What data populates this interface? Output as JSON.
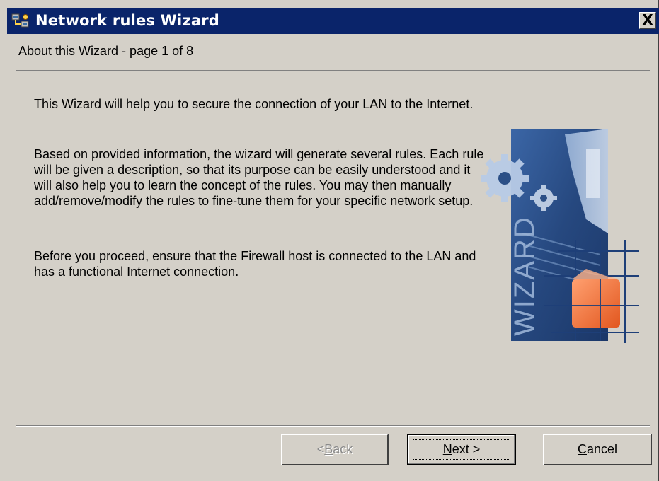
{
  "window": {
    "title": "Network rules Wizard",
    "close_label": "X"
  },
  "header": {
    "subtitle": "About this Wizard - page 1 of 8"
  },
  "content": {
    "paragraphs": [
      "This Wizard will help you to secure the connection of your LAN to the Internet.",
      "Based on provided information, the wizard will generate several rules. Each rule will be given a description, so that its purpose can be easily understood and it will also help you to learn the concept of the rules. You may then manually add/remove/modify the rules to fine-tune them for your specific network setup.",
      "Before you proceed, ensure that the Firewall host is connected to the LAN and has a functional Internet connection."
    ],
    "wizard_image_text": "WIZARD"
  },
  "buttons": {
    "back": {
      "prefix": "< ",
      "mnemonic": "B",
      "rest": "ack",
      "enabled": false
    },
    "next": {
      "mnemonic": "N",
      "rest": "ext >",
      "enabled": true,
      "default": true
    },
    "cancel": {
      "mnemonic": "C",
      "rest": "ancel",
      "enabled": true
    }
  },
  "colors": {
    "titlebar": "#0a246a",
    "face": "#d4d0c8",
    "art_blue": "#2b4f86",
    "art_orange": "#f07a40"
  }
}
